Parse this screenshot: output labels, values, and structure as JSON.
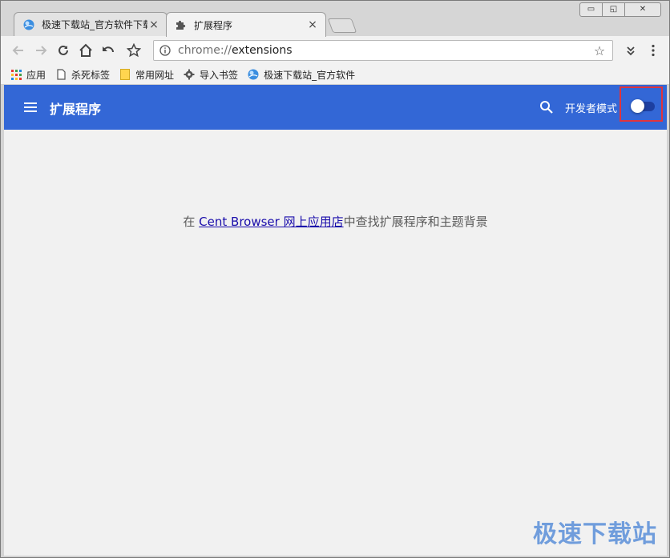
{
  "window": {
    "controls": {
      "minimize": "▭",
      "restore": "◱",
      "close": "✕"
    }
  },
  "tabs": [
    {
      "title": "极速下载站_官方软件下载",
      "icon": "site-globe-icon",
      "close": "×"
    },
    {
      "title": "扩展程序",
      "icon": "puzzle-icon",
      "close": "×"
    }
  ],
  "omnibox": {
    "scheme": "chrome://",
    "path": "extensions"
  },
  "bookmarks": [
    {
      "label": "应用",
      "icon": "apps-grid-icon"
    },
    {
      "label": "杀死标签",
      "icon": "page-icon"
    },
    {
      "label": "常用网址",
      "icon": "folder-icon"
    },
    {
      "label": "导入书签",
      "icon": "gear-icon"
    },
    {
      "label": "极速下载站_官方软件",
      "icon": "site-globe-icon"
    }
  ],
  "extensions_page": {
    "title": "扩展程序",
    "developer_mode_label": "开发者模式",
    "developer_mode_enabled": false,
    "store_prefix": "在 ",
    "store_link": "Cent Browser 网上应用店",
    "store_suffix": "中查找扩展程序和主题背景"
  },
  "watermark": "极速下载站",
  "colors": {
    "header": "#3367d6",
    "highlight_box": "#e0343c",
    "link": "#1a0dab"
  }
}
